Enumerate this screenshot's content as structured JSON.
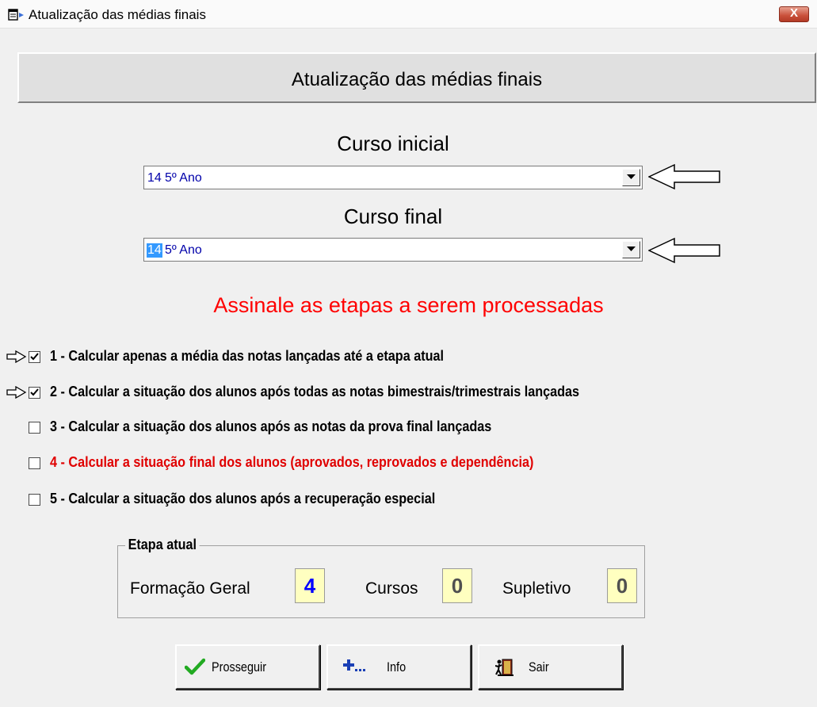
{
  "window": {
    "title": "Atualização das médias finais",
    "close_label": "X",
    "app_icon": "window-app-icon"
  },
  "header": {
    "title": "Atualização das médias finais"
  },
  "curso_inicial": {
    "label": "Curso inicial",
    "code": "14",
    "name": "5º Ano",
    "pointer_icon": "arrow-left-outline-icon"
  },
  "curso_final": {
    "label": "Curso final",
    "code": "14",
    "name": "5º Ano",
    "code_selected": true,
    "pointer_icon": "arrow-left-outline-icon"
  },
  "instruction": "Assinale as etapas a serem processadas",
  "options": [
    {
      "label": "1 - Calcular apenas a média das notas lançadas até a etapa atual",
      "checked": true,
      "pointer": true,
      "color": "#000000"
    },
    {
      "label": "2 - Calcular a situação dos alunos após todas as notas bimestrais/trimestrais lançadas",
      "checked": true,
      "pointer": true,
      "color": "#000000"
    },
    {
      "label": "3 - Calcular a situação dos alunos após as notas da prova final lançadas",
      "checked": false,
      "pointer": false,
      "color": "#000000"
    },
    {
      "label": "4 - Calcular a situação final dos alunos (aprovados, reprovados e dependência)",
      "checked": false,
      "pointer": false,
      "color": "#e00000"
    },
    {
      "label": "5 - Calcular a situação dos alunos após a recuperação especial",
      "checked": false,
      "pointer": false,
      "color": "#000000"
    }
  ],
  "etapa_atual": {
    "title": "Etapa atual",
    "formacao_geral": {
      "label": "Formação Geral",
      "value": "4"
    },
    "cursos": {
      "label": "Cursos",
      "value": "0"
    },
    "supletivo": {
      "label": "Supletivo",
      "value": "0"
    }
  },
  "buttons": {
    "prosseguir": {
      "label": "Prosseguir",
      "icon": "checkmark-icon"
    },
    "info": {
      "label": "Info",
      "icon": "plus-info-icon"
    },
    "sair": {
      "label": "Sair",
      "icon": "exit-door-icon"
    }
  }
}
